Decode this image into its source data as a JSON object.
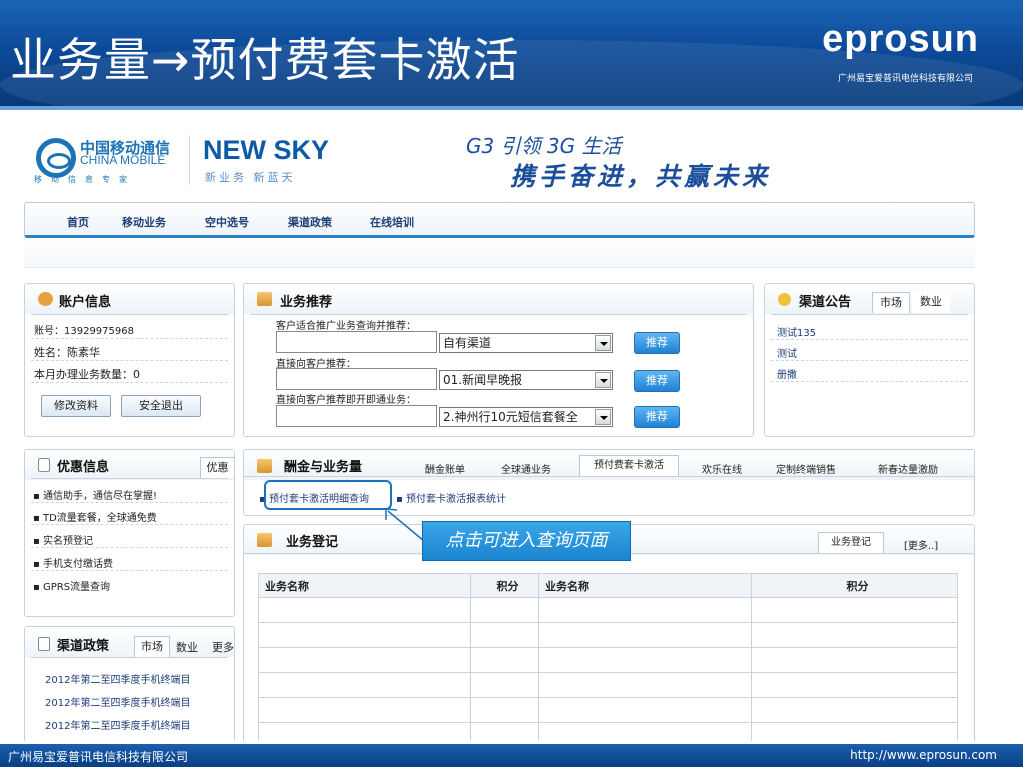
{
  "slide": {
    "title": "业务量→预付费套卡激活",
    "logo": "eprosun",
    "logo_sub": "广州易宝爱普讯电信科技有限公司",
    "footer_left": "广州易宝爱普讯电信科技有限公司",
    "footer_right": "http://www.eprosun.com"
  },
  "brand": {
    "cm_cn": "中国移动通信",
    "cm_en": "CHINA MOBILE",
    "cm_slogan": "移动信息专家",
    "ns_en": "NEW SKY",
    "ns_cn": "新业务 新蓝天",
    "slogan1": "G3 引领 3G 生活",
    "slogan2": "携手奋进，共赢未来"
  },
  "nav": [
    "首页",
    "移动业务",
    "空中选号",
    "渠道政策",
    "在线培训"
  ],
  "account": {
    "title": "账户信息",
    "phone": "账号：13929975968",
    "name": "姓名：陈素华",
    "count": "本月办理业务数量：0",
    "edit": "修改资料",
    "logout": "安全退出"
  },
  "recommend": {
    "title": "业务推荐",
    "label1": "客户适合推广业务查询并推荐：",
    "label2": "直接向客户推荐：",
    "label3": "直接向客户推荐即开即通业务：",
    "sel1": "自有渠道",
    "sel2": "01.新闻早晚报",
    "sel3": "2.神州行10元短信套餐全",
    "btn": "推荐"
  },
  "notice": {
    "title": "渠道公告",
    "tabs": [
      "市场",
      "数业"
    ],
    "items": [
      "测试135",
      "测试",
      "册撒"
    ]
  },
  "promo": {
    "title": "优惠信息",
    "tab": "优惠",
    "items": [
      "通信助手，通信尽在掌握!",
      "TD流量套餐，全球通免费",
      "实名预登记",
      "手机支付缴话费",
      "GPRS流量查询"
    ]
  },
  "policy": {
    "title": "渠道政策",
    "tabs": [
      "市场",
      "数业",
      "更多"
    ],
    "items": [
      "2012年第二至四季度手机终端目",
      "2012年第二至四季度手机终端目",
      "2012年第二至四季度手机终端目"
    ]
  },
  "rewards": {
    "title": "酬金与业务量",
    "tabs": [
      "酬金账单",
      "全球通业务",
      "预付费套卡激活",
      "欢乐在线",
      "定制终端销售",
      "新春达量激励"
    ],
    "link1": "预付套卡激活明细查询",
    "link2": "预付套卡激活报表统计"
  },
  "callout": "点击可进入查询页面",
  "register": {
    "title": "业务登记",
    "tabs": [
      "业务登记",
      "[更多..]"
    ],
    "columns": [
      "业务名称",
      "积分",
      "业务名称",
      "积分"
    ]
  }
}
